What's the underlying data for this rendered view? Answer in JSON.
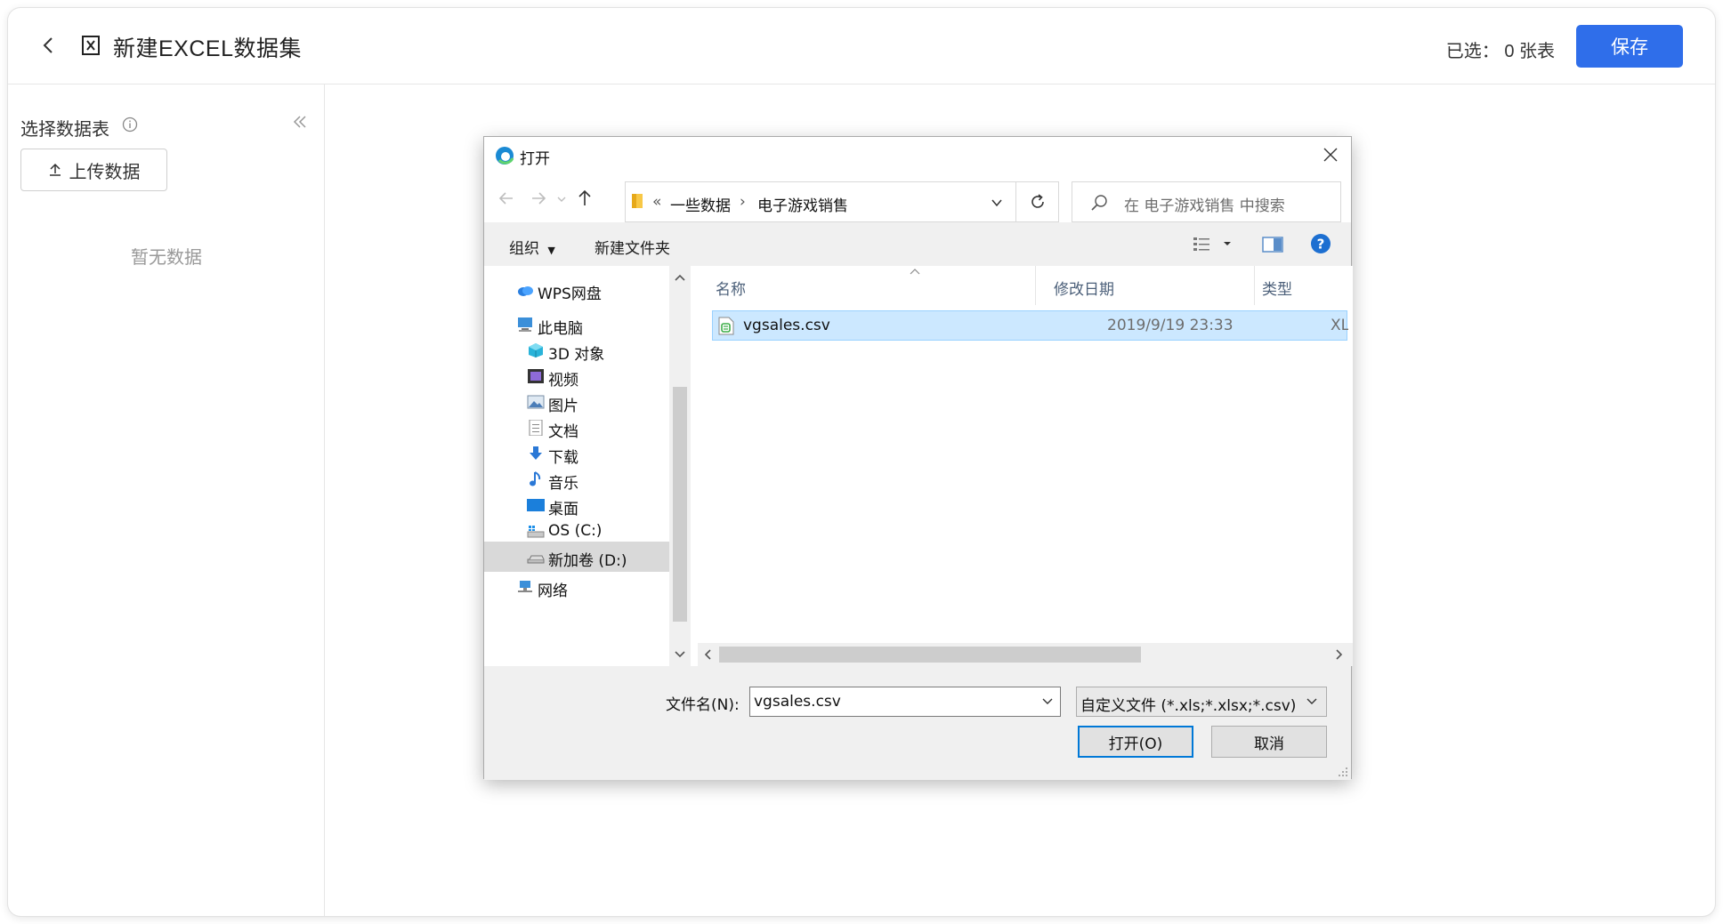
{
  "app": {
    "title": "新建EXCEL数据集",
    "selected_label": "已选：",
    "selected_count": "0 张表",
    "save_label": "保存",
    "accent_color": "#2f6eea"
  },
  "sidebar": {
    "title": "选择数据表",
    "upload_label": "上传数据",
    "empty_text": "暂无数据"
  },
  "dialog": {
    "title": "打开",
    "breadcrumb": [
      "«",
      "一些数据",
      "›",
      "电子游戏销售"
    ],
    "search_placeholder": "在 电子游戏销售 中搜索",
    "toolbar": {
      "organize": "组织",
      "new_folder": "新建文件夹"
    },
    "nav_items": [
      {
        "label": "WPS网盘",
        "icon": "cloud-icon"
      },
      {
        "label": "此电脑",
        "icon": "computer-icon"
      },
      {
        "label": "3D 对象",
        "icon": "cube-icon"
      },
      {
        "label": "视频",
        "icon": "video-icon"
      },
      {
        "label": "图片",
        "icon": "pictures-icon"
      },
      {
        "label": "文档",
        "icon": "document-icon"
      },
      {
        "label": "下载",
        "icon": "download-icon"
      },
      {
        "label": "音乐",
        "icon": "music-icon"
      },
      {
        "label": "桌面",
        "icon": "desktop-icon"
      },
      {
        "label": "OS (C:)",
        "icon": "drive-c-icon"
      },
      {
        "label": "新加卷 (D:)",
        "icon": "drive-d-icon",
        "selected": true
      },
      {
        "label": "网络",
        "icon": "network-icon"
      }
    ],
    "columns": [
      "名称",
      "修改日期",
      "类型"
    ],
    "files": [
      {
        "name": "vgsales.csv",
        "modified": "2019/9/19 23:33",
        "type": "XLS"
      }
    ],
    "filename_label": "文件名(N):",
    "filename_value": "vgsales.csv",
    "filter_value": "自定义文件 (*.xls;*.xlsx;*.csv)",
    "open_label": "打开(O)",
    "cancel_label": "取消"
  }
}
